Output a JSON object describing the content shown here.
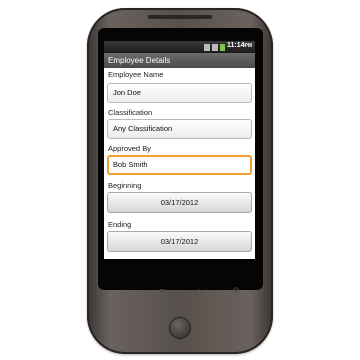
{
  "status_bar": {
    "time": "11:14",
    "time_suffix": "PM",
    "icons": [
      "sync-icon",
      "signal-icon",
      "battery-icon"
    ]
  },
  "app_title": "Employee Details",
  "form": {
    "employee_name_label": "Employee Name",
    "employee_name_value": "Jon Doe",
    "classification_label": "Classification",
    "classification_value": "Any Classification",
    "approved_by_label": "Approved By",
    "approved_by_value": "Bob Smith",
    "beginning_label": "Beginning",
    "beginning_value": "03/17/2012",
    "ending_label": "Ending",
    "ending_value": "03/17/2012"
  },
  "nav_icons": [
    "back-icon",
    "menu-icon",
    "home-icon",
    "search-icon"
  ],
  "colors": {
    "focus_border": "#f0a030",
    "title_bar": "#5a5a5a",
    "phone_body": "#57504b"
  }
}
